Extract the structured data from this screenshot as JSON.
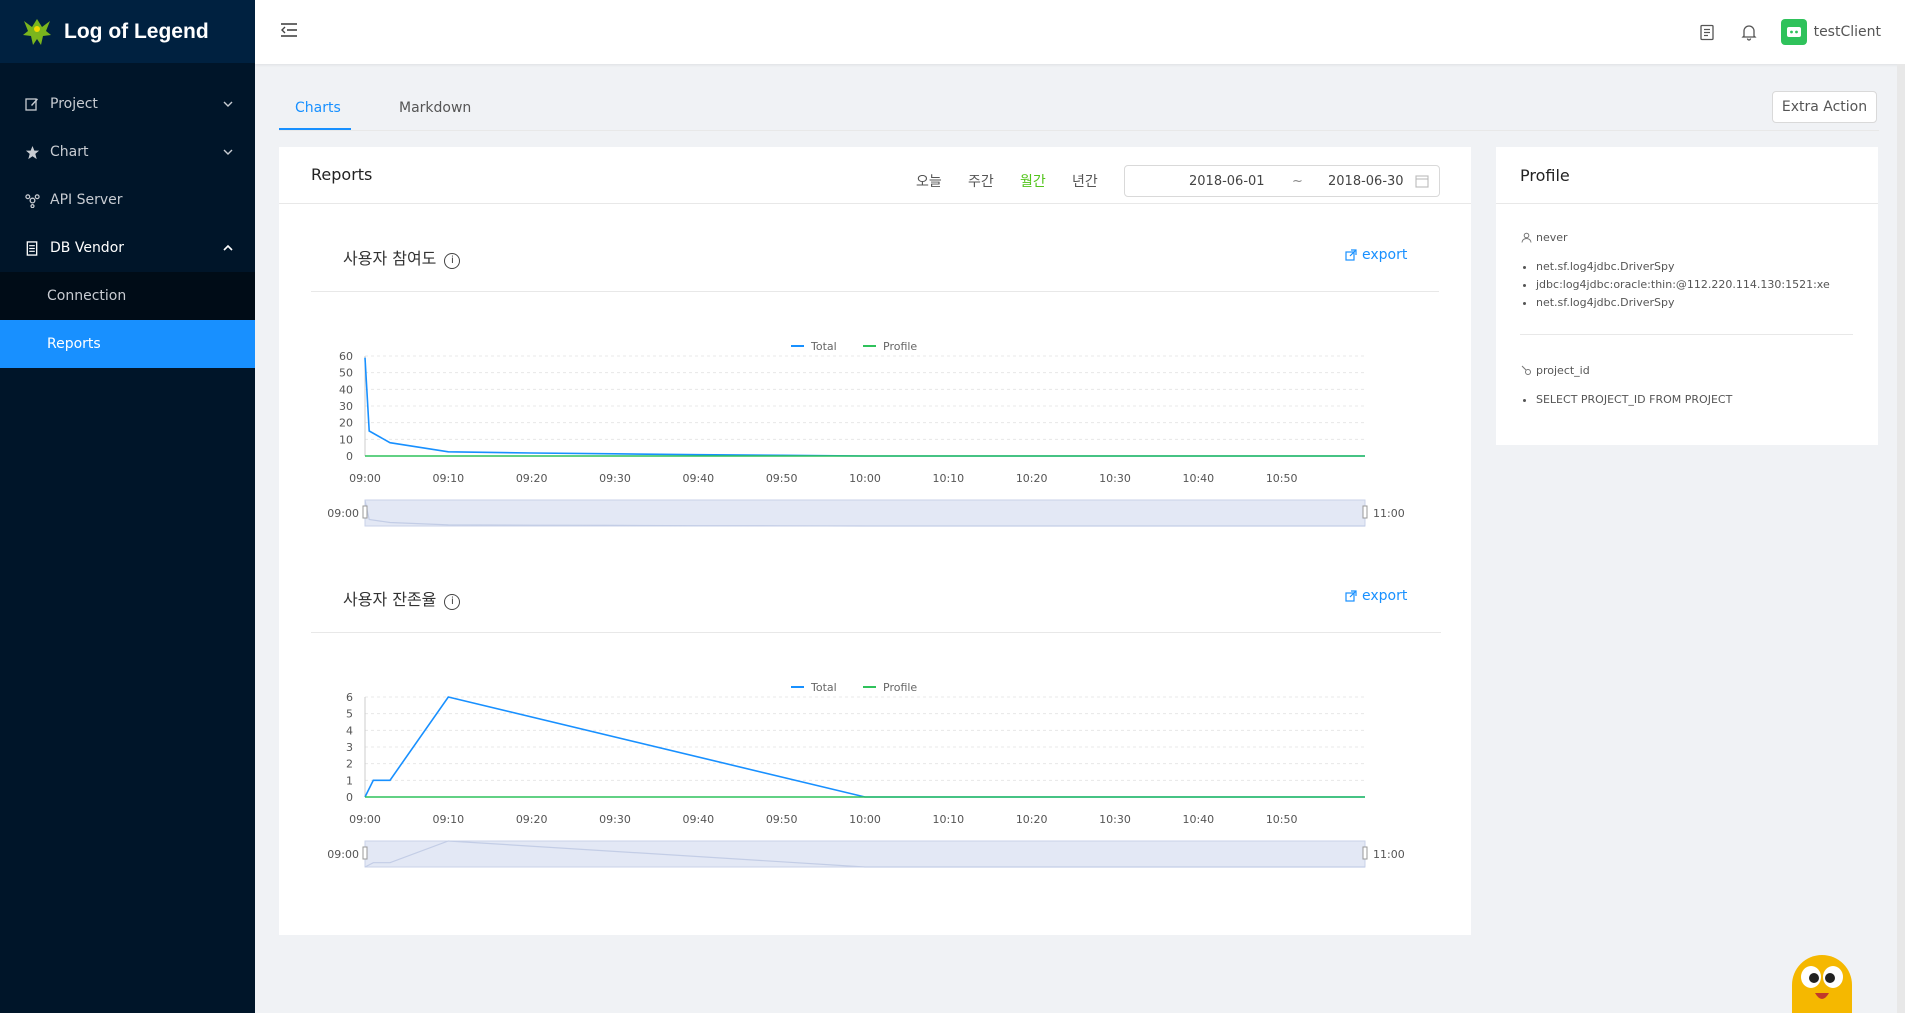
{
  "app": {
    "title": "Log of Legend"
  },
  "sidebar": {
    "items": [
      {
        "label": "Project",
        "icon": "edit-icon"
      },
      {
        "label": "Chart",
        "icon": "star-icon"
      },
      {
        "label": "API Server",
        "icon": "api-icon"
      },
      {
        "label": "DB Vendor",
        "icon": "database-icon"
      }
    ],
    "sub_items": [
      {
        "label": "Connection"
      },
      {
        "label": "Reports"
      }
    ]
  },
  "header": {
    "user": "testClient"
  },
  "tabs": [
    {
      "label": "Charts"
    },
    {
      "label": "Markdown"
    }
  ],
  "extra_action": "Extra Action",
  "reports": {
    "title": "Reports",
    "periods": [
      "오늘",
      "주간",
      "월간",
      "년간"
    ],
    "active_period": "월간",
    "date_from": "2018-06-01",
    "date_sep": "~",
    "date_to": "2018-06-30",
    "export_label": "export"
  },
  "profile": {
    "title": "Profile",
    "label1": "never",
    "list1": [
      "net.sf.log4jdbc.DriverSpy",
      "jdbc:log4jdbc:oracle:thin:@112.220.114.130:1521:xe",
      "net.sf.log4jdbc.DriverSpy"
    ],
    "label2": "project_id",
    "list2": [
      "SELECT PROJECT_ID FROM PROJECT"
    ]
  },
  "colors": {
    "total": "#1890ff",
    "profile": "#2fc25b",
    "accent": "#1890ff",
    "sidebar": "#001529"
  },
  "chart_data": [
    {
      "type": "line",
      "title": "사용자 참여도",
      "legend": [
        "Total",
        "Profile"
      ],
      "legend_position": "top-center",
      "x_ticks": [
        "09:00",
        "09:10",
        "09:20",
        "09:30",
        "09:40",
        "09:50",
        "10:00",
        "10:10",
        "10:20",
        "10:30",
        "10:40",
        "10:50"
      ],
      "x_range_minutes": [
        0,
        120
      ],
      "y_ticks": [
        0,
        10,
        20,
        30,
        40,
        50,
        60
      ],
      "ylim": [
        0,
        60
      ],
      "grid": true,
      "series": [
        {
          "name": "Total",
          "points": [
            [
              0,
              59
            ],
            [
              0.5,
              15
            ],
            [
              3,
              8
            ],
            [
              10,
              2.5
            ],
            [
              20,
              1.8
            ],
            [
              30,
              1.3
            ],
            [
              40,
              0.8
            ],
            [
              50,
              0.4
            ],
            [
              60,
              0
            ],
            [
              120,
              0
            ]
          ]
        },
        {
          "name": "Profile",
          "points": [
            [
              0,
              0
            ],
            [
              120,
              0
            ]
          ]
        }
      ],
      "zoom": {
        "start": "09:00",
        "end": "11:00"
      }
    },
    {
      "type": "line",
      "title": "사용자 잔존율",
      "legend": [
        "Total",
        "Profile"
      ],
      "legend_position": "top-center",
      "x_ticks": [
        "09:00",
        "09:10",
        "09:20",
        "09:30",
        "09:40",
        "09:50",
        "10:00",
        "10:10",
        "10:20",
        "10:30",
        "10:40",
        "10:50"
      ],
      "x_range_minutes": [
        0,
        120
      ],
      "y_ticks": [
        0,
        1,
        2,
        3,
        4,
        5,
        6
      ],
      "ylim": [
        0,
        6
      ],
      "grid": true,
      "series": [
        {
          "name": "Total",
          "points": [
            [
              0,
              0
            ],
            [
              1,
              1
            ],
            [
              3,
              1
            ],
            [
              10,
              6
            ],
            [
              60,
              0
            ],
            [
              120,
              0
            ]
          ]
        },
        {
          "name": "Profile",
          "points": [
            [
              0,
              0
            ],
            [
              120,
              0
            ]
          ]
        }
      ],
      "zoom": {
        "start": "09:00",
        "end": "11:00"
      }
    }
  ]
}
